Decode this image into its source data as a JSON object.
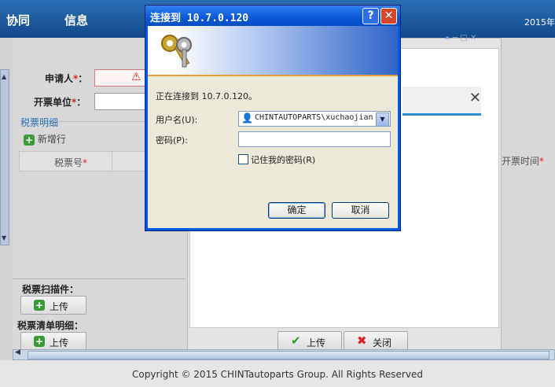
{
  "topbar": {
    "nav1": "协同",
    "nav2": "信息",
    "year": "2015年"
  },
  "form": {
    "applicant_label": "申请人",
    "invoice_unit_label": "开票单位",
    "required_mark": "*",
    "section_title": "税票明细",
    "add_row_label": "新增行",
    "col_invoice_no": "税票号",
    "col_invoice_time": "开票时间",
    "scan_label": "税票扫描件：",
    "list_label": "税票清单明细：",
    "upload_label": "上传"
  },
  "panel": {
    "upload_button": "上传",
    "close_button": "关闭"
  },
  "footer": {
    "copyright": "Copyright © 2015 CHINTautoparts Group. All Rights Reserved"
  },
  "dialog": {
    "title": "连接到 10.7.0.120",
    "message": "正在连接到 10.7.0.120。",
    "username_label": "用户名(U):",
    "username_value": "CHINTAUTOPARTS\\xuchaojian",
    "password_label": "密码(P):",
    "password_value": "",
    "remember_label": "记住我的密码(R)",
    "ok_label": "确定",
    "cancel_label": "取消",
    "help_glyph": "?",
    "close_glyph": "✕"
  },
  "colors": {
    "titlebar": "#0a58d8",
    "dialog_body": "#ece9d8",
    "accent": "#2a6fb5",
    "required": "#dd2222"
  }
}
